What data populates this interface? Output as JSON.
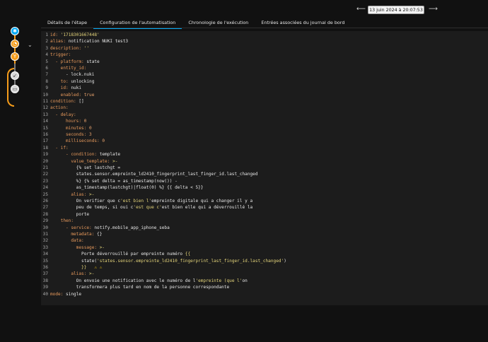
{
  "header": {
    "date_value": "13 juin 2024 à 20:07:53",
    "nav_prev_icon": "arrow-left",
    "nav_next_icon": "arrow-right"
  },
  "tabs": [
    {
      "label": "Détails de l'étape"
    },
    {
      "label": "Configuration de l'automatisation"
    },
    {
      "label": "Chronologie de l'exécution"
    },
    {
      "label": "Entrées associées du journal de bord"
    }
  ],
  "trace": {
    "nodes": [
      "trigger-icon",
      "delay-icon",
      "condition-icon",
      "skipped-icon",
      "message-icon"
    ]
  },
  "editor": {
    "lines": [
      [
        [
          "k",
          "id: "
        ],
        [
          "s",
          "'1718301667448'"
        ]
      ],
      [
        [
          "k",
          "alias: "
        ],
        [
          "w",
          "notification NUKI test3"
        ]
      ],
      [
        [
          "k",
          "description: "
        ],
        [
          "s",
          "''"
        ]
      ],
      [
        [
          "k",
          "trigger:"
        ]
      ],
      [
        [
          "k",
          "  - platform: "
        ],
        [
          "w",
          "state"
        ]
      ],
      [
        [
          "k",
          "    entity_id:"
        ]
      ],
      [
        [
          "w",
          "      - lock.nuki"
        ]
      ],
      [
        [
          "k",
          "    to: "
        ],
        [
          "w",
          "unlocking"
        ]
      ],
      [
        [
          "k",
          "    id: "
        ],
        [
          "w",
          "nuki"
        ]
      ],
      [
        [
          "k",
          "    enabled: "
        ],
        [
          "n",
          "true"
        ]
      ],
      [
        [
          "k",
          "condition: "
        ],
        [
          "w",
          "[]"
        ]
      ],
      [
        [
          "k",
          "action:"
        ]
      ],
      [
        [
          "k",
          "  - delay:"
        ]
      ],
      [
        [
          "k",
          "      hours: "
        ],
        [
          "n",
          "0"
        ]
      ],
      [
        [
          "k",
          "      minutes: "
        ],
        [
          "n",
          "0"
        ]
      ],
      [
        [
          "k",
          "      seconds: "
        ],
        [
          "n",
          "3"
        ]
      ],
      [
        [
          "k",
          "      milliseconds: "
        ],
        [
          "n",
          "0"
        ]
      ],
      [
        [
          "k",
          "  - if:"
        ]
      ],
      [
        [
          "k",
          "      - condition: "
        ],
        [
          "w",
          "template"
        ]
      ],
      [
        [
          "k",
          "        value_template: "
        ],
        [
          "s",
          ">-"
        ]
      ],
      [
        [
          "w",
          "          {% set lastchgt ="
        ]
      ],
      [
        [
          "w",
          "          states.sensor.empreinte_ld2410_fingerprint_last_finger_id.last_changed"
        ]
      ],
      [
        [
          "w",
          "          %} {% set delta = as_timestamp(now()) -"
        ]
      ],
      [
        [
          "w",
          "          as_timestamp(lastchgt)|float(0) %} {{ delta < 5}}"
        ]
      ],
      [
        [
          "k",
          "        alias: "
        ],
        [
          "s",
          ">-"
        ]
      ],
      [
        [
          "w",
          "          On verifier que c"
        ],
        [
          "s",
          "'est bien l'"
        ],
        [
          "w",
          "empreinte digitale qui a changer il y a"
        ]
      ],
      [
        [
          "w",
          "          peu de temps, si oui c"
        ],
        [
          "s",
          "'est que c'"
        ],
        [
          "w",
          "est bien elle qui a déverrouillé la"
        ]
      ],
      [
        [
          "w",
          "          porte"
        ]
      ],
      [
        [
          "k",
          "    then:"
        ]
      ],
      [
        [
          "k",
          "      - service: "
        ],
        [
          "w",
          "notify.mobile_app_iphone_seba"
        ]
      ],
      [
        [
          "k",
          "        metadata: "
        ],
        [
          "w",
          "{}"
        ]
      ],
      [
        [
          "k",
          "        data:"
        ]
      ],
      [
        [
          "k",
          "          message: "
        ],
        [
          "s",
          ">-"
        ]
      ],
      [
        [
          "w",
          "            Porte déverrouillé par empreinte numéro "
        ],
        [
          "s",
          "{{"
        ]
      ],
      [
        [
          "w",
          "            state("
        ],
        [
          "s",
          "'states.sensor.empreinte_ld2410_fingerprint_last_finger_id.last_changed'"
        ],
        [
          "w",
          ")"
        ]
      ],
      [
        [
          "s",
          "            }}"
        ],
        [
          "warn",
          "   ⚠ ⚠"
        ]
      ],
      [
        [
          "k",
          "        alias: "
        ],
        [
          "s",
          ">-"
        ]
      ],
      [
        [
          "w",
          "          On envoie une notification avec le numéro de l"
        ],
        [
          "s",
          "'empreinte (que l'"
        ],
        [
          "w",
          "on"
        ]
      ],
      [
        [
          "w",
          "          transformera plus tard en nom de la personne correspondante"
        ]
      ],
      [
        [
          "k",
          "mode: "
        ],
        [
          "w",
          "single"
        ]
      ]
    ]
  }
}
